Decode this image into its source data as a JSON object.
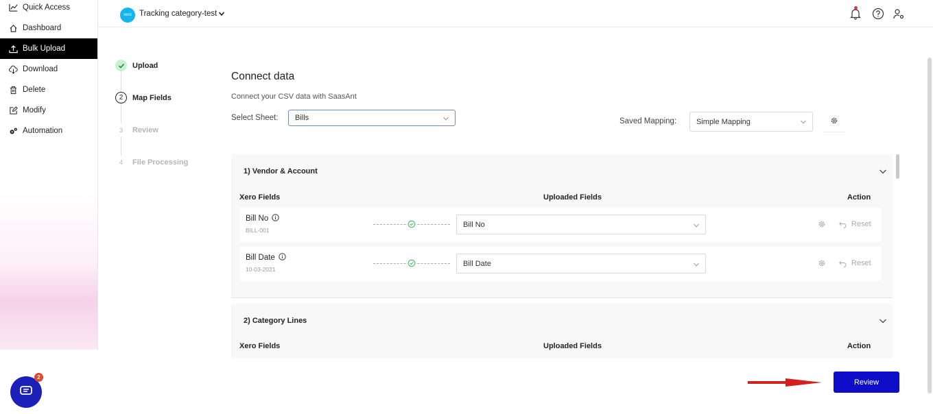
{
  "sidebar": {
    "items": [
      {
        "label": "Quick Access",
        "icon": "chart-line-icon"
      },
      {
        "label": "Dashboard",
        "icon": "home-icon"
      },
      {
        "label": "Bulk Upload",
        "icon": "upload-icon",
        "active": true
      },
      {
        "label": "Download",
        "icon": "cloud-download-icon"
      },
      {
        "label": "Delete",
        "icon": "trash-icon"
      },
      {
        "label": "Modify",
        "icon": "edit-icon"
      },
      {
        "label": "Automation",
        "icon": "gears-icon"
      }
    ]
  },
  "header": {
    "org_logo_text": "xero",
    "org_name": "Tracking category-test"
  },
  "stepper": {
    "steps": [
      {
        "number": "",
        "label": "Upload",
        "state": "done"
      },
      {
        "number": "2",
        "label": "Map Fields",
        "state": "current"
      },
      {
        "number": "3",
        "label": "Review",
        "state": "future"
      },
      {
        "number": "4",
        "label": "File Processing",
        "state": "future"
      }
    ]
  },
  "main": {
    "title": "Connect data",
    "subtitle": "Connect your CSV data with SaasAnt",
    "select_sheet_label": "Select Sheet:",
    "select_sheet_value": "Bills",
    "saved_mapping_label": "Saved Mapping:",
    "saved_mapping_value": "Simple Mapping"
  },
  "sections": [
    {
      "title": "1) Vendor & Account",
      "col_xero": "Xero Fields",
      "col_uploaded": "Uploaded Fields",
      "col_action": "Action",
      "rows": [
        {
          "field": "Bill No",
          "sample": "BILL-001",
          "mapped": "Bill No",
          "reset": "Reset"
        },
        {
          "field": "Bill Date",
          "sample": "10-03-2021",
          "mapped": "Bill Date",
          "reset": "Reset"
        }
      ]
    },
    {
      "title": "2) Category Lines",
      "col_xero": "Xero Fields",
      "col_uploaded": "Uploaded Fields",
      "col_action": "Action"
    }
  ],
  "footer": {
    "review_label": "Review",
    "chat_badge": "2"
  },
  "colors": {
    "accent": "#0e0ec9",
    "success": "#c8f0d3",
    "notification": "#e53935",
    "arrow": "#d32020"
  }
}
